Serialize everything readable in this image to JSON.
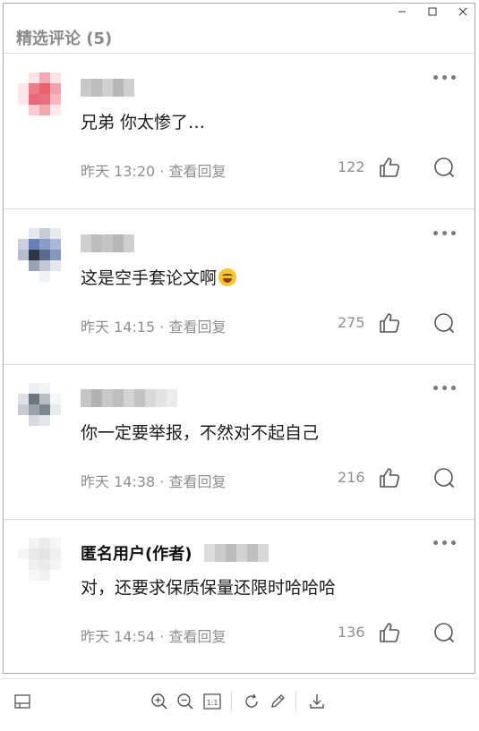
{
  "window": {
    "title": "精选评论 (5)"
  },
  "comments": [
    {
      "author_real": "",
      "author_blurred": true,
      "text": "兄弟 你太惨了…",
      "time": "昨天 13:20",
      "action": "查看回复",
      "likes": "122",
      "emoji": false,
      "avatar_colors": [
        "#ffffff",
        "#fbe4e7",
        "#f4a8b2",
        "#fbe3e6",
        "#ffffff",
        "#fde6ea",
        "#ec7c8a",
        "#e8626f",
        "#f3a2ad",
        "#ffffff",
        "#fde5e9",
        "#e9697a",
        "#e8707e",
        "#f6b6bf",
        "#ffffff",
        "#ffffff",
        "#f8ccd2",
        "#f3a9b2",
        "#fde9ec",
        "#ffffff",
        "#ffffff",
        "#ffffff",
        "#ffffff",
        "#ffffff",
        "#ffffff"
      ],
      "name_colors": [
        "#c9c9c9",
        "#bdbdbd",
        "#d0d0d0",
        "#b7b7b7",
        "#cfcfcf"
      ]
    },
    {
      "author_real": "",
      "author_blurred": true,
      "text": "这是空手套论文啊",
      "time": "昨天 14:15",
      "action": "查看回复",
      "likes": "275",
      "emoji": true,
      "avatar_colors": [
        "#ffffff",
        "#e4e7ee",
        "#c8ccd8",
        "#e7eaf0",
        "#ffffff",
        "#c9d0e1",
        "#6a7fb8",
        "#8a9cc8",
        "#aab7d8",
        "#ffffff",
        "#b7bdcc",
        "#2f3647",
        "#5b6a8f",
        "#8796bd",
        "#ffffff",
        "#ffffff",
        "#9aa3b5",
        "#c3c8d4",
        "#e5e7ed",
        "#ffffff",
        "#ffffff",
        "#ffffff",
        "#f1f2f5",
        "#ffffff",
        "#ffffff"
      ],
      "name_colors": [
        "#cfcfcf",
        "#bdbdbd",
        "#c4c4c4",
        "#b7b7b7",
        "#cfcfcf"
      ]
    },
    {
      "author_real": "",
      "author_blurred": true,
      "text": "你一定要举报，不然对不起自己",
      "time": "昨天 14:38",
      "action": "查看回复",
      "likes": "216",
      "emoji": false,
      "avatar_colors": [
        "#ffffff",
        "#eceef0",
        "#f3f4f5",
        "#ffffff",
        "#ffffff",
        "#dde0e4",
        "#6c7480",
        "#b9bec6",
        "#f5f6f7",
        "#ffffff",
        "#c8ccd2",
        "#9aa1ab",
        "#7e8692",
        "#e8eaed",
        "#ffffff",
        "#ffffff",
        "#d7dade",
        "#e4e6e9",
        "#ffffff",
        "#ffffff",
        "#ffffff",
        "#ffffff",
        "#ffffff",
        "#ffffff",
        "#ffffff"
      ],
      "name_colors": [
        "#c5c5c5",
        "#b2b2b2",
        "#c8c8c8",
        "#bfbfbf",
        "#d4d4d4",
        "#c2c2c2",
        "#d9d9d9",
        "#e3e3e3",
        "#ececec"
      ]
    },
    {
      "author_real": "匿名用户(作者)",
      "author_blurred": true,
      "text": "对，还要求保质保量还限时哈哈哈",
      "time": "昨天 14:54",
      "action": "查看回复",
      "likes": "136",
      "emoji": false,
      "avatar_colors": [
        "#ffffff",
        "#f3f3f3",
        "#ececec",
        "#f6f6f6",
        "#ffffff",
        "#f5f5f5",
        "#e9e9e9",
        "#e4e4e4",
        "#f0f0f0",
        "#ffffff",
        "#ffffff",
        "#efefef",
        "#ebebeb",
        "#f4f4f4",
        "#ffffff",
        "#ffffff",
        "#f7f7f7",
        "#f2f2f2",
        "#ffffff",
        "#ffffff",
        "#ffffff",
        "#ffffff",
        "#ffffff",
        "#ffffff",
        "#ffffff"
      ],
      "name_colors": [
        "#dcdcdc",
        "#cbcbcb",
        "#bcbcbc",
        "#d3d3d3",
        "#c0c0c0",
        "#d8d8d8"
      ]
    }
  ],
  "toolbar": {
    "icons": [
      "sidebar-icon",
      "zoom-in-icon",
      "zoom-out-icon",
      "actual-size-icon",
      "rotate-icon",
      "edit-icon",
      "download-icon"
    ],
    "actual_size_label": "1:1"
  },
  "more_label": "•••"
}
